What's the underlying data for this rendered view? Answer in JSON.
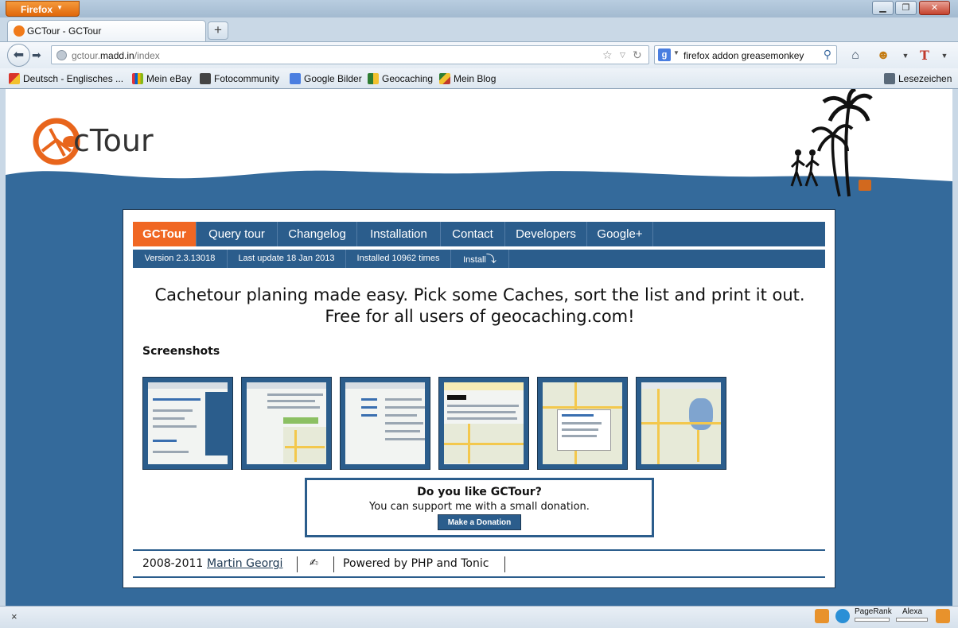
{
  "browser": {
    "app_menu": "Firefox",
    "tab_title": "GCTour - GCTour",
    "new_tab": "+",
    "url_prefix": "gctour.",
    "url_host": "madd.in",
    "url_path": "/index",
    "search_value": "firefox addon greasemonkey",
    "window_buttons": [
      "minimize",
      "maximize",
      "close"
    ]
  },
  "bookmarks": {
    "items": [
      "Deutsch - Englisches ...",
      "Mein eBay",
      "Fotocommunity",
      "Google Bilder",
      "Geocaching",
      "Mein Blog"
    ],
    "right": "Lesezeichen"
  },
  "page": {
    "nav": [
      "GCTour",
      "Query tour",
      "Changelog",
      "Installation",
      "Contact",
      "Developers",
      "Google+"
    ],
    "active_nav": "GCTour",
    "info": {
      "version": "Version 2.3.13018",
      "last_update": "Last update 18 Jan 2013",
      "installed": "Installed 10962 times",
      "install": "Install"
    },
    "headline_line1": "Cachetour planing made easy. Pick some Caches, sort the list and print it out.",
    "headline_line2": "Free for all users of geocaching.com!",
    "screenshots_title": "Screenshots",
    "screenshots": [
      "screenshot-1",
      "screenshot-2",
      "screenshot-3",
      "screenshot-4",
      "screenshot-5",
      "screenshot-6"
    ],
    "donate": {
      "title": "Do you like GCTour?",
      "text": "You can support me with a small donation.",
      "button": "Make a Donation"
    },
    "footer": {
      "years": "2008-2011",
      "author": "Martin Georgi",
      "powered": "Powered by PHP and Tonic"
    }
  },
  "statusbar": {
    "close": "×",
    "pagerank": "PageRank",
    "alexa": "Alexa"
  },
  "colors": {
    "brand_orange": "#f06723",
    "nav_blue": "#2b5d8c",
    "wave_blue": "#346a9b"
  }
}
